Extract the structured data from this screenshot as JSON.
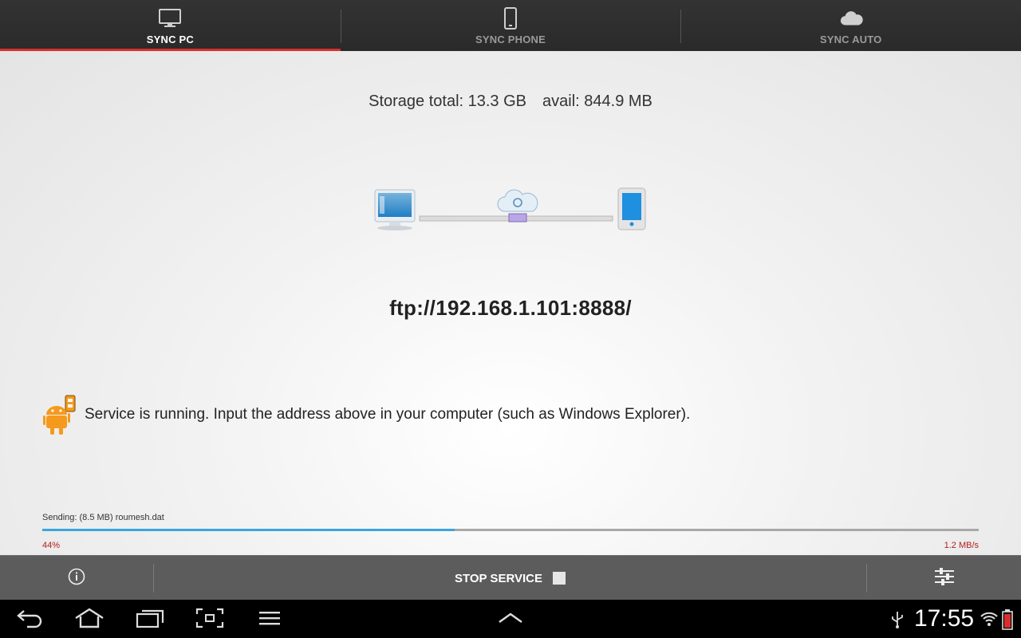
{
  "tabs": [
    {
      "label": "SYNC PC",
      "icon": "monitor-icon",
      "active": true
    },
    {
      "label": "SYNC PHONE",
      "icon": "phone-icon",
      "active": false
    },
    {
      "label": "SYNC AUTO",
      "icon": "cloud-icon",
      "active": false
    }
  ],
  "storage": {
    "total": "Storage total: 13.3 GB",
    "avail": "avail: 844.9 MB"
  },
  "address": "ftp://192.168.1.101:8888/",
  "status": {
    "text": "Service is running. Input the address above in your computer (such as Windows Explorer).",
    "icon": "android-usb-icon"
  },
  "transfer": {
    "sending": "Sending: (8.5 MB) roumesh.dat",
    "percent_label": "44%",
    "percent": 44,
    "speed": "1.2 MB/s"
  },
  "actionbar": {
    "info_icon": "info-icon",
    "stop_label": "STOP SERVICE",
    "settings_icon": "sliders-icon"
  },
  "systembar": {
    "time": "17:55",
    "icons": [
      "back-icon",
      "home-icon",
      "recent-apps-icon",
      "screenshot-icon",
      "menu-icon",
      "chevron-up-icon",
      "usb-icon",
      "wifi-icon",
      "battery-icon"
    ]
  },
  "colors": {
    "accent": "#d92e2e",
    "progress": "#3aa6dc",
    "percent_text": "#b02020"
  }
}
